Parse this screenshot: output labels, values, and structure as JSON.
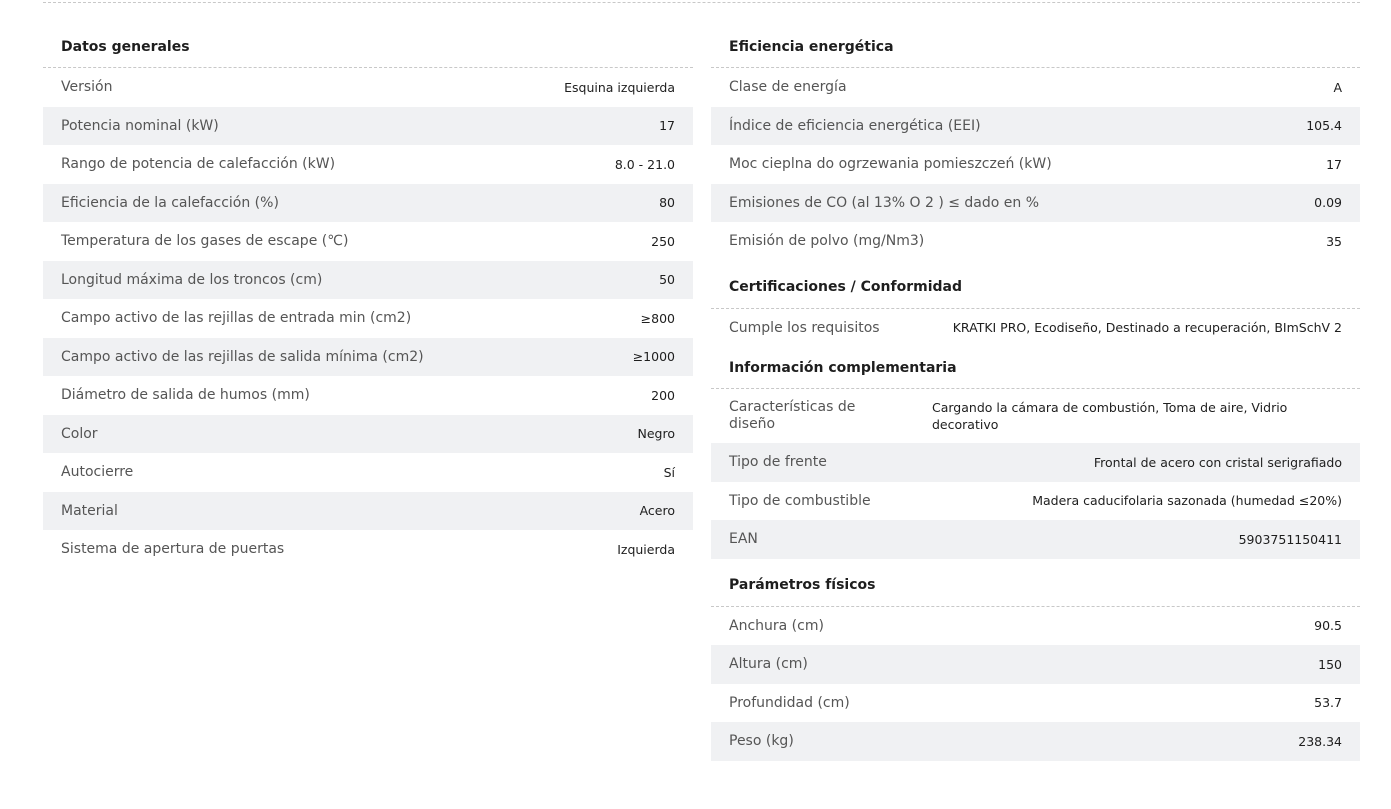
{
  "general": {
    "title": "Datos generales",
    "rows": [
      {
        "label": "Versión",
        "value": "Esquina izquierda"
      },
      {
        "label": "Potencia nominal (kW)",
        "value": "17"
      },
      {
        "label": "Rango de potencia de calefacción (kW)",
        "value": "8.0 - 21.0"
      },
      {
        "label": "Eficiencia de la calefacción (%)",
        "value": "80"
      },
      {
        "label": "Temperatura de los gases de escape (℃)",
        "value": "250"
      },
      {
        "label": "Longitud máxima de los troncos (cm)",
        "value": "50"
      },
      {
        "label": "Campo activo de las rejillas de entrada min (cm2)",
        "value": "≥800"
      },
      {
        "label": "Campo activo de las rejillas de salida mínima (cm2)",
        "value": "≥1000"
      },
      {
        "label": "Diámetro de salida de humos (mm)",
        "value": "200"
      },
      {
        "label": "Color",
        "value": "Negro"
      },
      {
        "label": "Autocierre",
        "value": "Sí"
      },
      {
        "label": "Material",
        "value": "Acero"
      },
      {
        "label": "Sistema de apertura de puertas",
        "value": "Izquierda"
      }
    ]
  },
  "energy": {
    "title": "Eficiencia energética",
    "rows": [
      {
        "label": "Clase de energía",
        "value": "A"
      },
      {
        "label": "Índice de eficiencia energética (EEI)",
        "value": "105.4"
      },
      {
        "label": "Moc cieplna do ogrzewania pomieszczeń (kW)",
        "value": "17"
      },
      {
        "label": "Emisiones de CO (al 13% O 2 ) ≤ dado en %",
        "value": "0.09"
      },
      {
        "label": "Emisión de polvo (mg/Nm3)",
        "value": "35"
      }
    ]
  },
  "certifications": {
    "title": "Certificaciones / Conformidad",
    "rows": [
      {
        "label": "Cumple los requisitos",
        "value": "KRATKI PRO, Ecodiseño, Destinado a recuperación, BImSchV 2"
      }
    ]
  },
  "complementary": {
    "title": "Información complementaria",
    "rows": [
      {
        "label": "Características de diseño",
        "value": "Cargando la cámara de combustión, Toma de aire, Vidrio decorativo"
      },
      {
        "label": "Tipo de frente",
        "value": "Frontal de acero con cristal serigrafiado"
      },
      {
        "label": "Tipo de combustible",
        "value": "Madera caducifolaria sazonada (humedad ≤20%)"
      },
      {
        "label": "EAN",
        "value": "5903751150411"
      }
    ]
  },
  "physical": {
    "title": "Parámetros físicos",
    "rows": [
      {
        "label": "Anchura (cm)",
        "value": "90.5"
      },
      {
        "label": "Altura (cm)",
        "value": "150"
      },
      {
        "label": "Profundidad (cm)",
        "value": "53.7"
      },
      {
        "label": "Peso (kg)",
        "value": "238.34"
      }
    ]
  }
}
